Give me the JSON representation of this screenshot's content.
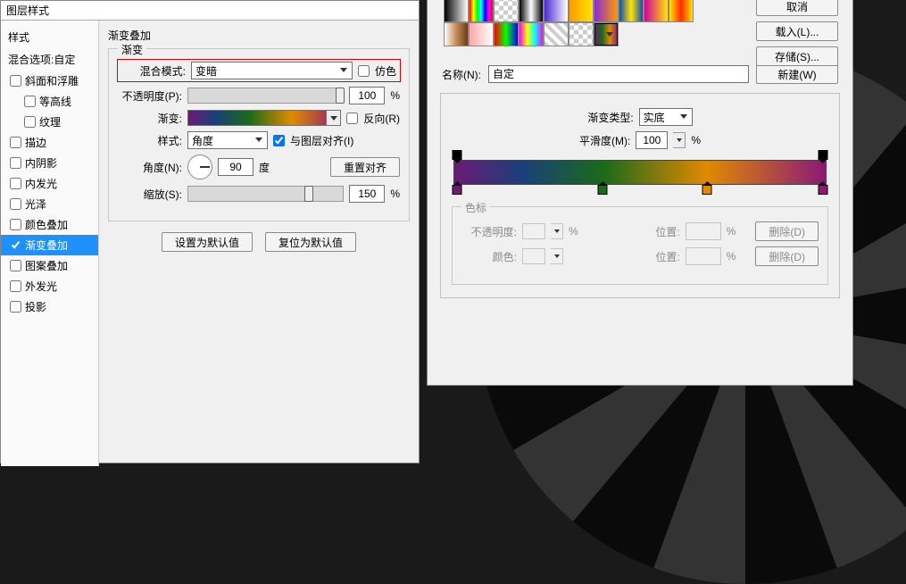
{
  "layerStyle": {
    "title": "图层样式",
    "sidebar": {
      "styles": "样式",
      "blendOpt": "混合选项:自定",
      "items": [
        {
          "label": "斜面和浮雕",
          "checked": false,
          "indent": false
        },
        {
          "label": "等高线",
          "checked": false,
          "indent": true
        },
        {
          "label": "纹理",
          "checked": false,
          "indent": true
        },
        {
          "label": "描边",
          "checked": false,
          "indent": false
        },
        {
          "label": "内阴影",
          "checked": false,
          "indent": false
        },
        {
          "label": "内发光",
          "checked": false,
          "indent": false
        },
        {
          "label": "光泽",
          "checked": false,
          "indent": false
        },
        {
          "label": "颜色叠加",
          "checked": false,
          "indent": false
        },
        {
          "label": "渐变叠加",
          "checked": true,
          "indent": false,
          "selected": true
        },
        {
          "label": "图案叠加",
          "checked": false,
          "indent": false
        },
        {
          "label": "外发光",
          "checked": false,
          "indent": false
        },
        {
          "label": "投影",
          "checked": false,
          "indent": false
        }
      ]
    },
    "panel": {
      "heading": "渐变叠加",
      "legend": "渐变",
      "blendModeLabel": "混合模式:",
      "blendModeValue": "变暗",
      "ditherLabel": "仿色",
      "opacityLabel": "不透明度(P):",
      "opacityValue": "100",
      "pct": "%",
      "gradientLabel": "渐变:",
      "reverseLabel": "反向(R)",
      "styleLabel": "样式:",
      "styleValue": "角度",
      "alignLabel": "与图层对齐(I)",
      "angleLabel": "角度(N):",
      "angleValue": "90",
      "deg": "度",
      "resetAlign": "重置对齐",
      "scaleLabel": "缩放(S):",
      "scaleValue": "150",
      "setDefault": "设置为默认值",
      "resetDefault": "复位为默认值"
    }
  },
  "gradEditor": {
    "buttons": {
      "cancel": "取消",
      "load": "载入(L)...",
      "save": "存储(S)...",
      "new": "新建(W)"
    },
    "nameLabel": "名称(N):",
    "nameValue": "自定",
    "typeLabel": "渐变类型:",
    "typeValue": "实底",
    "smoothLabel": "平滑度(M):",
    "smoothValue": "100",
    "pct": "%",
    "stopsLegend": "色标",
    "opLabel": "不透明度:",
    "locLabel": "位置:",
    "colorLabel": "颜色:",
    "delete": "删除(D)",
    "swatches": [
      "linear-gradient(90deg,#000,#fff)",
      "linear-gradient(90deg,#f00,#ff0,#0f0,#0ff,#00f,#f0f,#f00)",
      "repeating-conic-gradient(#ccc 0 25%,#fff 0 50%) 0/10px 10px",
      "linear-gradient(90deg,#000,#fff,#000)",
      "linear-gradient(90deg,#4b2bd6,#fff)",
      "linear-gradient(90deg,#ff9a00,#ffe600)",
      "linear-gradient(90deg,#8b2bd6,#ff9a00)",
      "linear-gradient(90deg,#104eab,#ffe600,#104eab)",
      "linear-gradient(90deg,#d400a0,#ffe600)",
      "linear-gradient(90deg,#ffe600,#ff2a00,#ffe600)",
      "linear-gradient(90deg,#fff,#c88c5a,#6b3b12)",
      "linear-gradient(90deg,#ffa6a6,#fff)",
      "linear-gradient(90deg,#f00,#0f0,#00f)",
      "linear-gradient(90deg,#f0f,#ff0,#0ff,#f0f)",
      "repeating-linear-gradient(45deg,#ccc 0 4px,#fff 4px 8px)",
      "repeating-conic-gradient(#ccc 0 25%,#fff 0 50%) 0/10px 10px",
      "linear-gradient(90deg,#6b1a76,#1a6a1a,#e08a00,#8a1a76)"
    ],
    "gradientStops": [
      {
        "pos": 0,
        "color": "#6b1a76"
      },
      {
        "pos": 40,
        "color": "#1a6a1a"
      },
      {
        "pos": 68,
        "color": "#e08a00"
      },
      {
        "pos": 100,
        "color": "#8a1a76"
      }
    ]
  }
}
